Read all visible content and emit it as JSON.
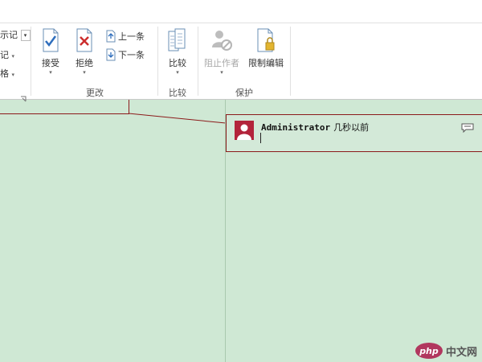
{
  "left_partial": {
    "items": [
      "示记",
      "记",
      "格"
    ]
  },
  "ribbon": {
    "groups": [
      {
        "label": "更改"
      },
      {
        "label": "比较"
      },
      {
        "label": "保护"
      }
    ],
    "changes": {
      "accept_label": "接受",
      "reject_label": "拒绝",
      "prev_label": "上一条",
      "next_label": "下一条"
    },
    "compare": {
      "compare_label": "比较"
    },
    "protect": {
      "block_authors_label": "阻止作者",
      "restrict_editing_label": "限制编辑"
    }
  },
  "comment": {
    "author": "Administrator",
    "time": "几秒以前",
    "body": "",
    "colors": {
      "avatar": "#b3243b",
      "border": "#8b1a1a"
    }
  },
  "watermark": {
    "logo": "php",
    "text": "中文网"
  },
  "icons": [
    "accept-icon",
    "reject-icon",
    "previous-icon",
    "next-icon",
    "compare-icon",
    "block-authors-icon",
    "restrict-editing-icon",
    "user-avatar-icon",
    "reply-icon",
    "dialog-launcher-icon"
  ],
  "colors": {
    "page_background": "#cfe8d4",
    "ribbon_background": "#ffffff",
    "accent_red": "#8b1a1a"
  }
}
